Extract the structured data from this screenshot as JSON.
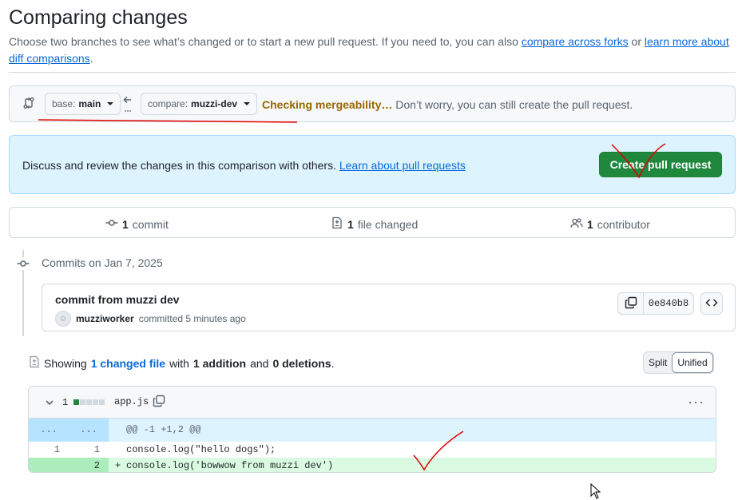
{
  "page": {
    "title": "Comparing changes",
    "description_prefix": "Choose two branches to see what’s changed or to start a new pull request. If you need to, you can also ",
    "link_forks": "compare across forks",
    "description_mid": " or ",
    "link_diff": "learn more about diff comparisons",
    "description_suffix": "."
  },
  "range": {
    "base_prefix": "base:",
    "base_branch": "main",
    "compare_prefix": "compare:",
    "compare_branch": "muzzi-dev",
    "checking": "Checking mergeability…",
    "checking_rest": " Don’t worry, you can still create the pull request."
  },
  "promo": {
    "text": "Discuss and review the changes in this comparison with others. ",
    "link": "Learn about pull requests",
    "create_button": "Create pull request"
  },
  "stats": {
    "commits_count": "1",
    "commits_label": "commit",
    "files_count": "1",
    "files_label": "file changed",
    "contributors_count": "1",
    "contributors_label": "contributor"
  },
  "commits": {
    "date_heading": "Commits on Jan 7, 2025",
    "items": [
      {
        "message": "commit from muzzi dev",
        "author": "muzziworker",
        "meta": "committed 5 minutes ago",
        "sha": "0e840b8"
      }
    ]
  },
  "files_summary": {
    "showing": "Showing",
    "changed_link": "1 changed file",
    "with": "with",
    "additions": "1 addition",
    "and": "and",
    "deletions": "0 deletions",
    "period": "."
  },
  "view_toggle": {
    "split": "Split",
    "unified": "Unified",
    "selected": "Unified"
  },
  "diff": {
    "changes": "1",
    "filename": "app.js",
    "kebab": "···",
    "hunk": {
      "left": "...",
      "right": "...",
      "header": "@@ -1 +1,2 @@"
    },
    "lines": [
      {
        "old": "1",
        "new": "1",
        "marker": " ",
        "code": "console.log(\"hello dogs\");"
      },
      {
        "old": "",
        "new": "2",
        "marker": "+",
        "code": "console.log('bowwow from muzzi dev')"
      }
    ]
  },
  "colors": {
    "accent": "#0969da",
    "create_button": "#1f883d",
    "warning": "#9a6700",
    "annotation": "#e00000"
  }
}
